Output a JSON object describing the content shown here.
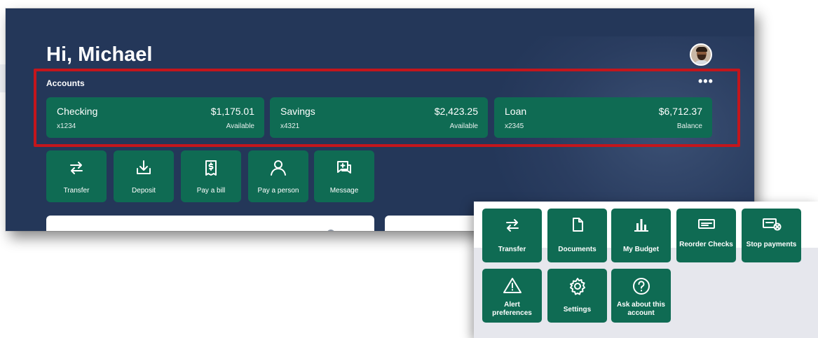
{
  "greeting": "Hi, Michael",
  "accounts": {
    "label": "Accounts",
    "more": "•••",
    "items": [
      {
        "name": "Checking",
        "number": "x1234",
        "amount": "$1,175.01",
        "status": "Available"
      },
      {
        "name": "Savings",
        "number": "x4321",
        "amount": "$2,423.25",
        "status": "Available"
      },
      {
        "name": "Loan",
        "number": "x2345",
        "amount": "$6,712.37",
        "status": "Balance"
      }
    ]
  },
  "quick_actions": [
    {
      "label": "Transfer",
      "icon": "transfer-icon"
    },
    {
      "label": "Deposit",
      "icon": "deposit-icon"
    },
    {
      "label": "Pay a bill",
      "icon": "bill-icon"
    },
    {
      "label": "Pay a person",
      "icon": "person-icon"
    },
    {
      "label": "Message",
      "icon": "message-icon"
    }
  ],
  "account_menu": [
    {
      "label": "Transfer",
      "icon": "transfer-icon"
    },
    {
      "label": "Documents",
      "icon": "document-icon"
    },
    {
      "label": "My Budget",
      "icon": "bar-chart-icon"
    },
    {
      "label": "Reorder Checks",
      "icon": "check-icon"
    },
    {
      "label": "Stop payments",
      "icon": "stop-payment-icon"
    },
    {
      "label": "Alert preferences",
      "icon": "alert-icon"
    },
    {
      "label": "Settings",
      "icon": "gear-icon"
    },
    {
      "label": "Ask about this account",
      "icon": "question-icon"
    }
  ],
  "colors": {
    "background": "#243759",
    "tile": "#0f6b53",
    "highlight": "#c4161c"
  }
}
